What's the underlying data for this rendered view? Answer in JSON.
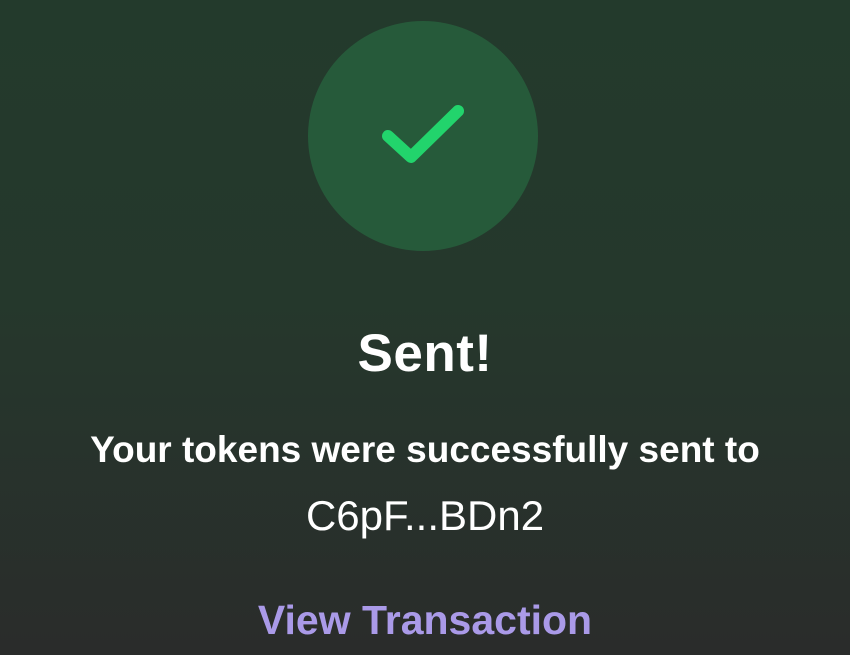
{
  "status": {
    "icon": "checkmark-icon",
    "title": "Sent!",
    "message": "Your tokens were successfully sent to",
    "recipient": "C6pF...BDn2"
  },
  "actions": {
    "view_transaction_label": "View Transaction"
  },
  "colors": {
    "success_green": "#22d46c",
    "circle_bg": "#265a3a",
    "link_purple": "#aa9ae8"
  }
}
